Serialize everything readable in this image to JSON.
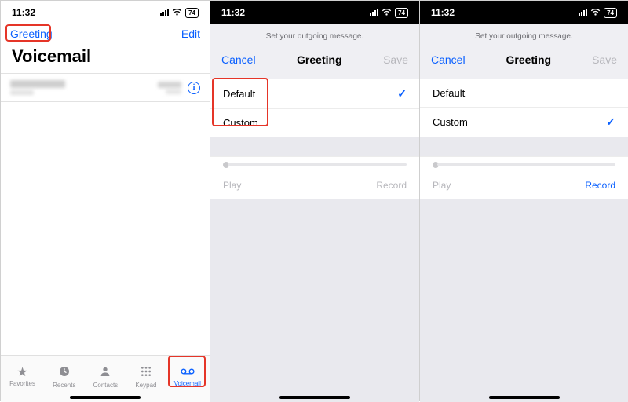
{
  "status": {
    "time": "11:32",
    "battery": "74"
  },
  "screen1": {
    "greeting": "Greeting",
    "edit": "Edit",
    "title": "Voicemail",
    "tabs": {
      "favorites": "Favorites",
      "recents": "Recents",
      "contacts": "Contacts",
      "keypad": "Keypad",
      "voicemail": "Voicemail"
    }
  },
  "sheet": {
    "hint": "Set your outgoing message.",
    "cancel": "Cancel",
    "title": "Greeting",
    "save": "Save",
    "options": {
      "default": "Default",
      "custom": "Custom"
    },
    "play": "Play",
    "record": "Record"
  }
}
